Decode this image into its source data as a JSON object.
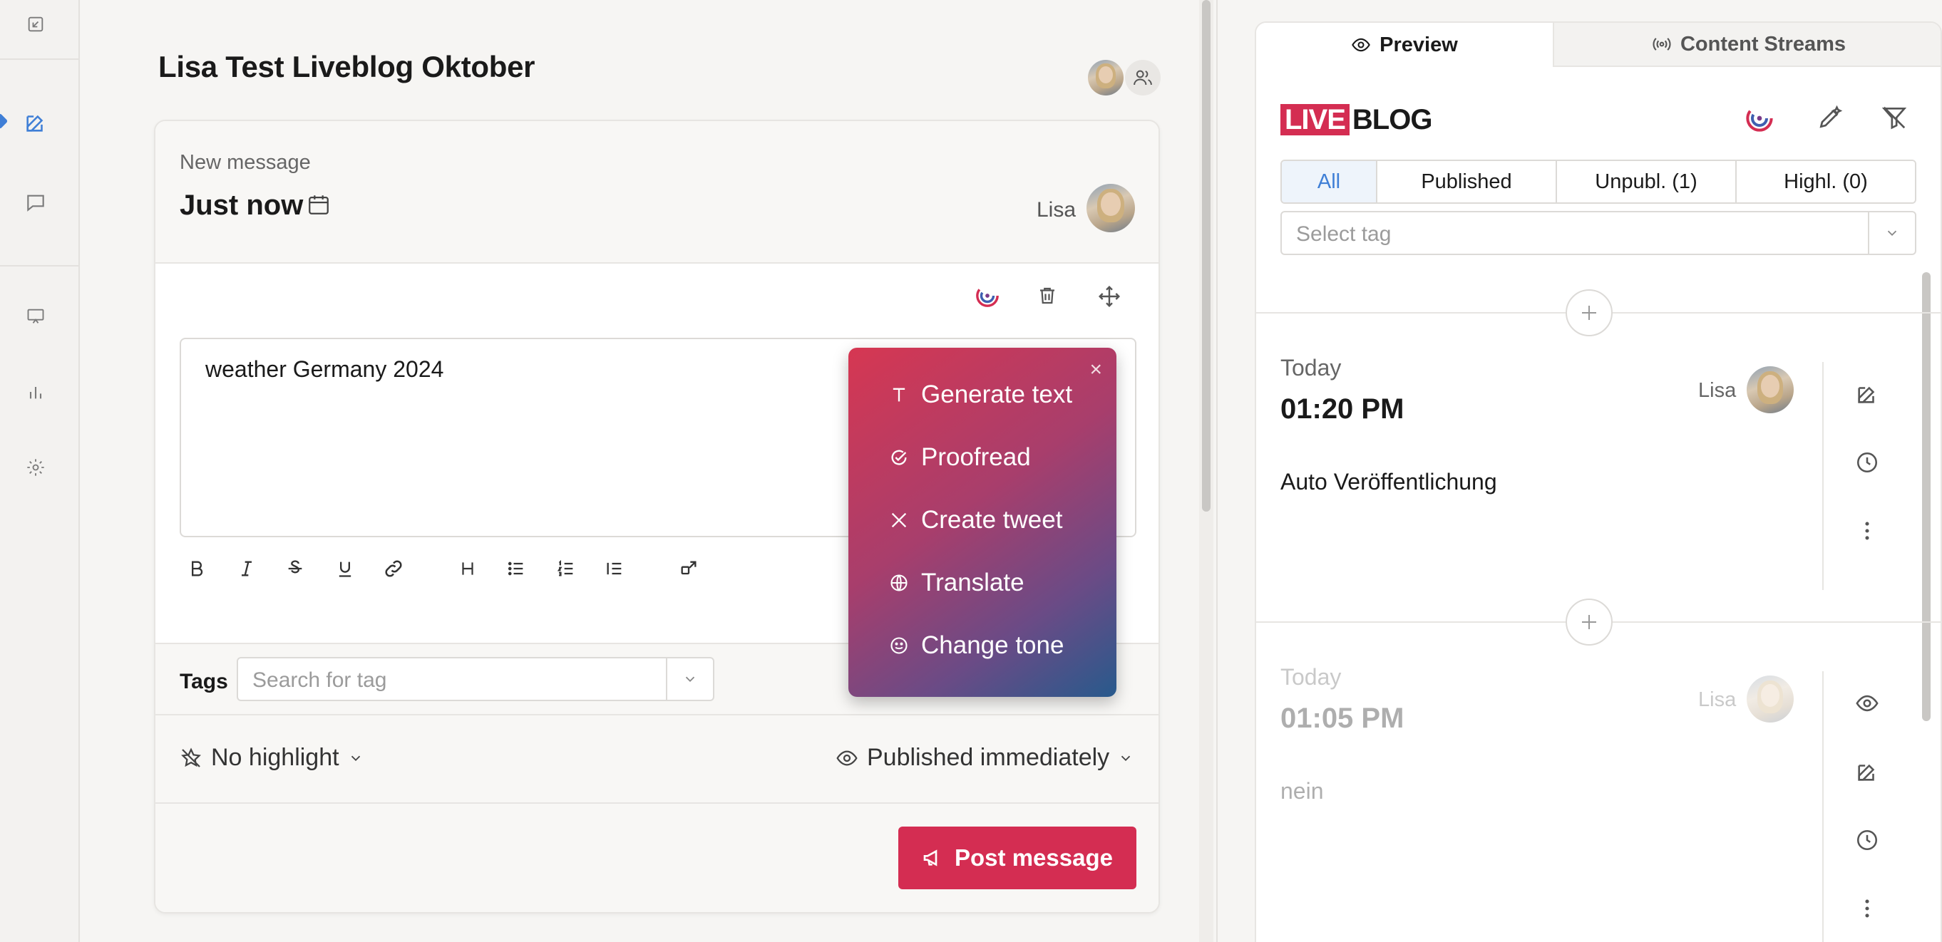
{
  "page": {
    "title": "Lisa Test Liveblog Oktober"
  },
  "editor": {
    "label": "New message",
    "time": "Just now",
    "author": "Lisa",
    "text_value": "weather Germany 2024",
    "tags_label": "Tags",
    "tags_placeholder": "Search for tag",
    "highlight": "No highlight",
    "publish": "Published immediately",
    "post_button": "Post message"
  },
  "ai_menu": {
    "close": "×",
    "items": [
      {
        "label": "Generate text",
        "icon": "text-icon"
      },
      {
        "label": "Proofread",
        "icon": "check-circle-icon"
      },
      {
        "label": "Create tweet",
        "icon": "x-logo-icon"
      },
      {
        "label": "Translate",
        "icon": "globe-icon"
      },
      {
        "label": "Change tone",
        "icon": "smiley-icon"
      }
    ]
  },
  "preview": {
    "tabs": [
      {
        "label": "Preview",
        "icon": "eye-icon"
      },
      {
        "label": "Content Streams",
        "icon": "broadcast-icon"
      }
    ],
    "logo": {
      "live": "LIVE",
      "blog": "BLOG"
    },
    "filters": [
      "All",
      "Published",
      "Unpubl. (1)",
      "Highl. (0)"
    ],
    "tag_placeholder": "Select tag",
    "posts": [
      {
        "day": "Today",
        "time": "01:20 PM",
        "author": "Lisa",
        "body": "Auto Veröffentlichung"
      },
      {
        "day": "Today",
        "time": "01:05 PM",
        "author": "Lisa",
        "body": "nein"
      }
    ]
  },
  "colors": {
    "brand": "#d42d52",
    "accent": "#3f7fd6"
  }
}
